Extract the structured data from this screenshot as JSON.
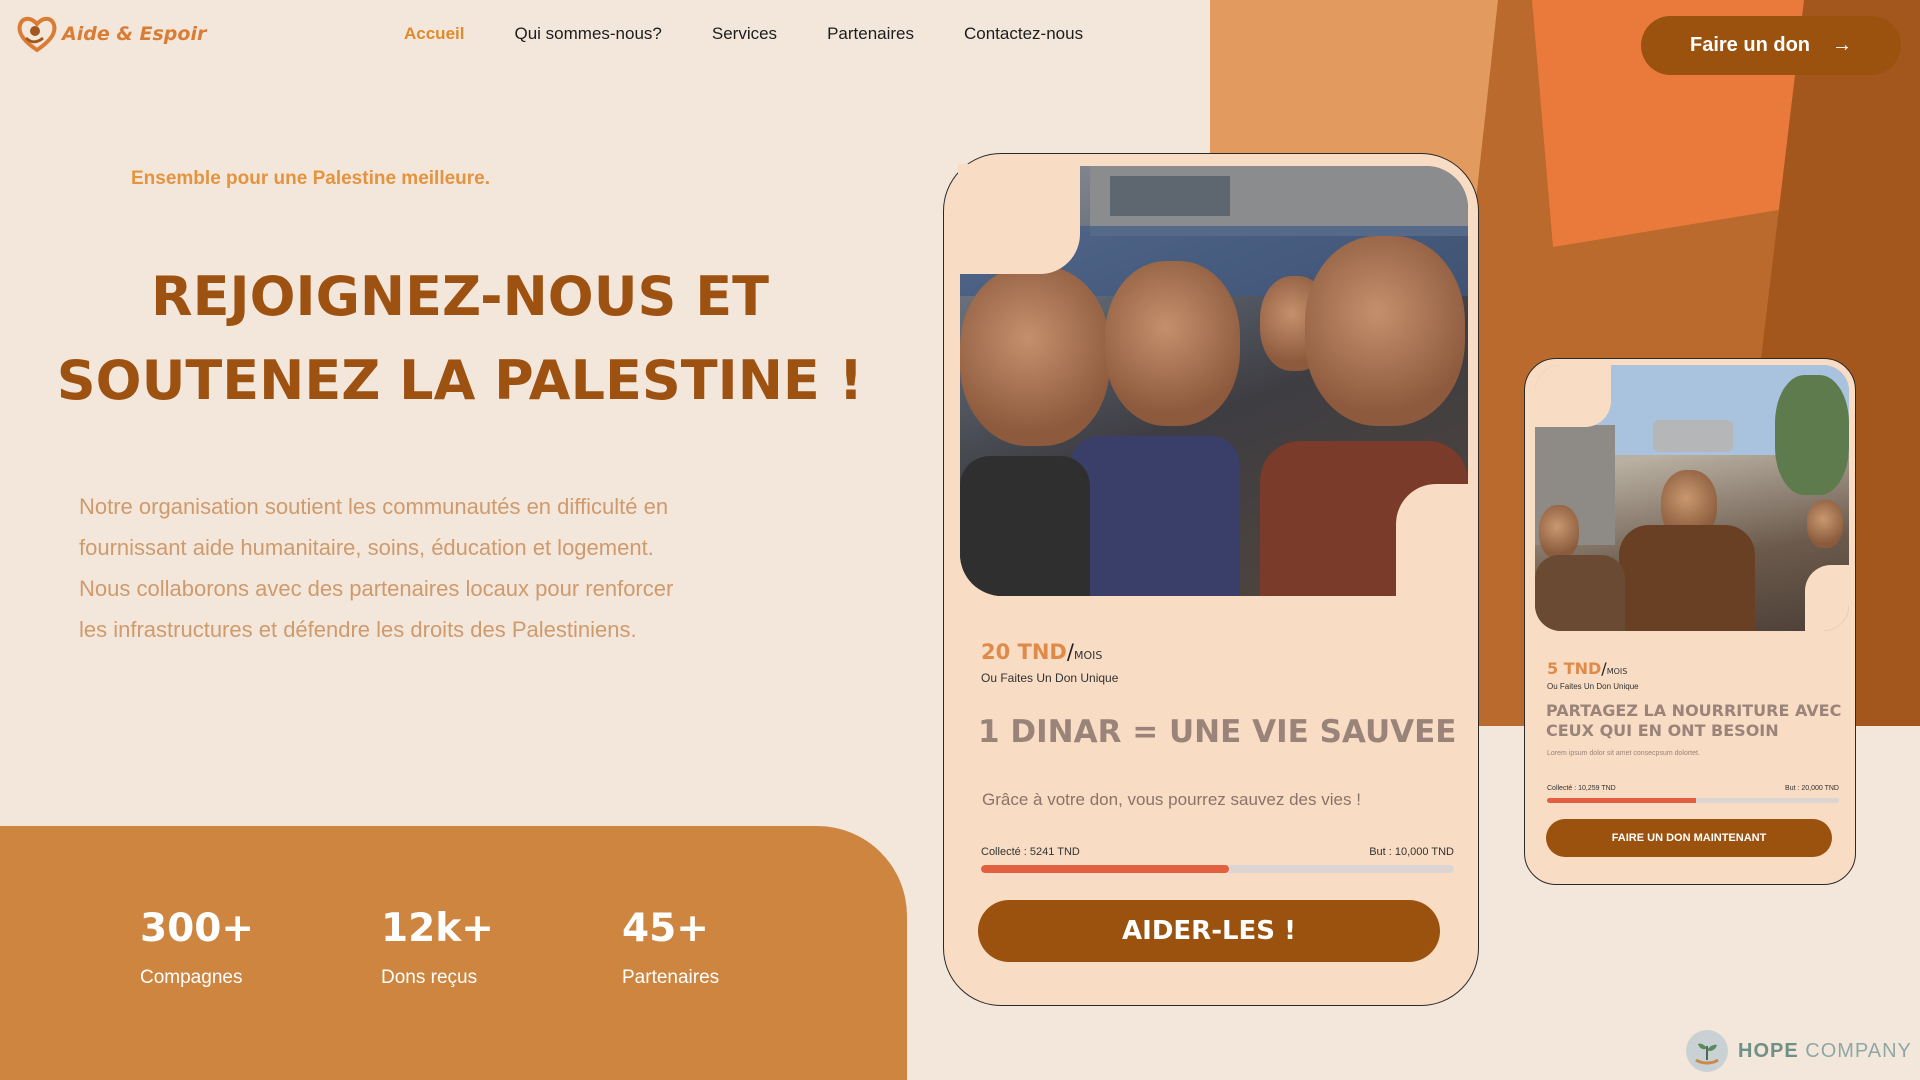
{
  "brand": {
    "name": "Aide & Espoir"
  },
  "nav": {
    "items": [
      "Accueil",
      "Qui sommes-nous?",
      "Services",
      "Partenaires",
      "Contactez-nous"
    ],
    "active": "Accueil"
  },
  "header": {
    "donate_label": "Faire un don",
    "donate_arrow": "→"
  },
  "hero": {
    "tagline": "Ensemble pour une Palestine meilleure.",
    "headline_line1": "REJOIGNEZ-NOUS ET",
    "headline_line2": "SOUTENEZ LA PALESTINE !",
    "intro": "Notre organisation soutient les communautés en difficulté en fournissant aide humanitaire, soins, éducation et logement. Nous collaborons avec des partenaires locaux pour renforcer les infrastructures et défendre les droits des Palestiniens."
  },
  "stats": [
    {
      "value": "300+",
      "label": "Compagnes"
    },
    {
      "value": "12k+",
      "label": "Dons reçus"
    },
    {
      "value": "45+",
      "label": "Partenaires"
    }
  ],
  "card_main": {
    "price": "20 TND",
    "slash": "/",
    "per": "MOIS",
    "subtitle": "Ou Faites Un Don Unique",
    "title": "1 DINAR = UNE VIE SAUVEE",
    "description": "Grâce à votre don, vous pourrez sauvez des vies !",
    "collected_label": "Collecté : 5241 TND",
    "goal_label": "But : 10,000 TND",
    "progress": 0.5241,
    "button": "AIDER-LES !"
  },
  "card_secondary": {
    "price": "5 TND",
    "slash": "/",
    "per": "MOIS",
    "subtitle": "Ou Faites Un Don Unique",
    "title": "PARTAGEZ LA NOURRITURE AVEC CEUX QUI EN ONT BESOIN",
    "lorem": "Lorem ipsum dolor sit amet consecpsum dolortet.",
    "collected_label": "Collecté : 10,259 TND",
    "goal_label": "But : 20,000 TND",
    "progress": 0.51,
    "button": "FAIRE UN DON MAINTENANT"
  },
  "watermark": {
    "word1": "HOPE",
    "word2": "COMPANY"
  },
  "colors": {
    "background": "#f3e7dc",
    "primary_brown": "#9a520e",
    "accent_orange": "#cd853f",
    "tagline_orange": "#e4933e",
    "card_bg": "#f8dcc4",
    "progress_fill": "#e2603f"
  }
}
